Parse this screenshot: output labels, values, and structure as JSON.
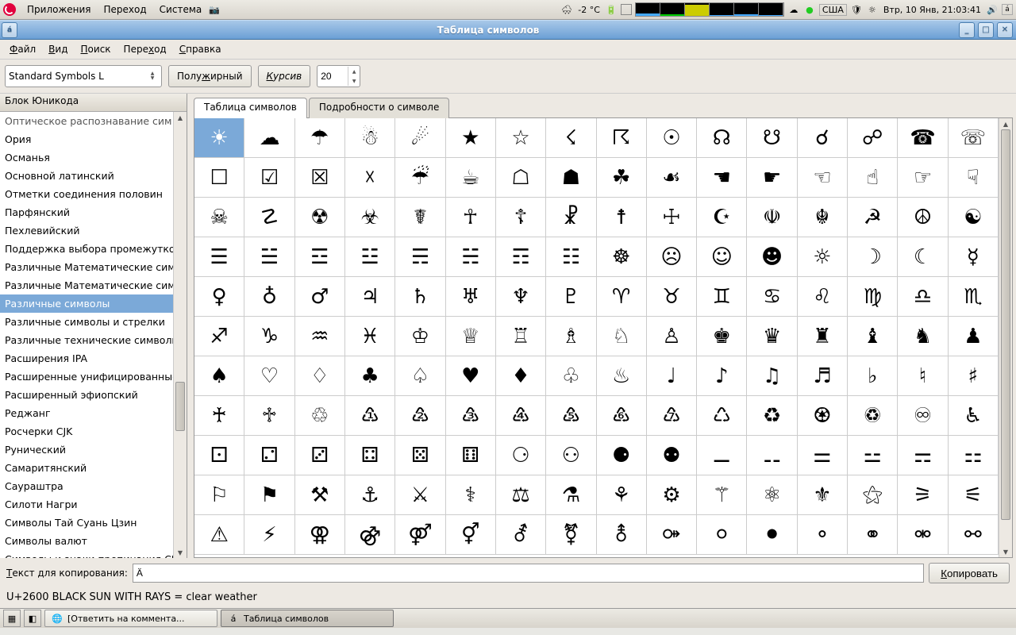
{
  "panel": {
    "menus": [
      "Приложения",
      "Переход",
      "Система"
    ],
    "weather": "-2 °C",
    "layout": "США",
    "clock": "Втр, 10 Янв, 21:03:41"
  },
  "window": {
    "title": "Таблица символов",
    "menus": [
      {
        "label": "Файл",
        "u": 0
      },
      {
        "label": "Вид",
        "u": 0
      },
      {
        "label": "Поиск",
        "u": 0
      },
      {
        "label": "Переход",
        "u": 4
      },
      {
        "label": "Справка",
        "u": 0
      }
    ]
  },
  "toolbar": {
    "font": "Standard Symbols L",
    "bold": "Полужирный",
    "italic": "Курсив",
    "size": "20"
  },
  "sidebar": {
    "header": "Блок Юникода",
    "items": [
      "Оптическое распознавание сим",
      "Ория",
      "Османья",
      "Основной латинский",
      "Отметки соединения половин",
      "Парфянский",
      "Пехлевийский",
      "Поддержка выбора промежутко",
      "Различные Математические сим",
      "Различные Математические сим",
      "Различные символы",
      "Различные символы и стрелки",
      "Различные технические символь",
      "Расширения IPA",
      "Расширенные унифицированные",
      "Расширенный эфиопский",
      "Реджанг",
      "Росчерки CJK",
      "Рунический",
      "Самаритянский",
      "Саураштра",
      "Силоти Нагри",
      "Символы Тай Суань Цзин",
      "Символы валют",
      "Символы и знаки препинания CJK"
    ],
    "selected": 10
  },
  "tabs": {
    "chars": "Таблица символов",
    "details": "Подробности о символе"
  },
  "grid": {
    "cols": 16,
    "start": 9728,
    "rows": 11,
    "selected": 0
  },
  "copy": {
    "label": "Текст для копирования:",
    "value": "Ä",
    "button": "Копировать"
  },
  "status": "U+2600 BLACK SUN WITH RAYS   = clear weather",
  "taskbar": {
    "task1": "[Ответить на коммента...",
    "task2": "Таблица символов"
  }
}
